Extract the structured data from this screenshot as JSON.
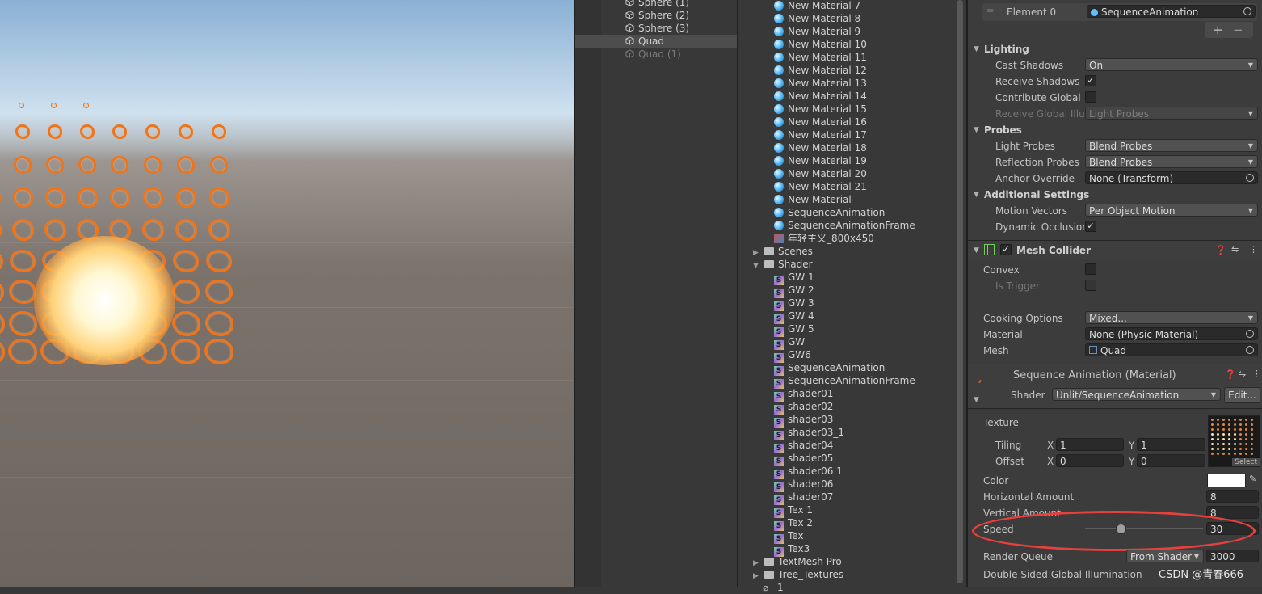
{
  "hierarchy": {
    "items": [
      "Sphere (1)",
      "Sphere (2)",
      "Sphere (3)",
      "Quad",
      "Quad (1)"
    ],
    "selected": "Quad"
  },
  "project": {
    "materials": [
      "New Material 7",
      "New Material 8",
      "New Material 9",
      "New Material 10",
      "New Material 11",
      "New Material 12",
      "New Material 13",
      "New Material 14",
      "New Material 15",
      "New Material 16",
      "New Material 17",
      "New Material 18",
      "New Material 19",
      "New Material 20",
      "New Material 21",
      "New Material",
      "SequenceAnimation",
      "SequenceAnimationFrame"
    ],
    "texture": "年轻主义_800x450",
    "folder_scenes": "Scenes",
    "folder_shader": "Shader",
    "shaders": [
      "GW 1",
      "GW 2",
      "GW 3",
      "GW 4",
      "GW 5",
      "GW",
      "GW6",
      "SequenceAnimation",
      "SequenceAnimationFrame",
      "shader01",
      "shader02",
      "shader03",
      "shader03_1",
      "shader04",
      "shader05",
      "shader06 1",
      "shader06",
      "shader07",
      "Tex 1",
      "Tex 2",
      "Tex",
      "Tex3"
    ],
    "folder_textmesh": "TextMesh Pro",
    "folder_tree": "Tree_Textures",
    "cutoff": "1"
  },
  "inspector": {
    "element0_label": "Element 0",
    "element0_value": "SequenceAnimation",
    "plus": "+",
    "minus": "−",
    "lighting": {
      "header": "Lighting",
      "cast_shadows_label": "Cast Shadows",
      "cast_shadows_value": "On",
      "receive_shadows_label": "Receive Shadows",
      "contribute_gi_label": "Contribute Global Ill",
      "receive_gi_label": "Receive Global Illum",
      "receive_gi_value": "Light Probes"
    },
    "probes": {
      "header": "Probes",
      "light_probes_label": "Light Probes",
      "light_probes_value": "Blend Probes",
      "reflection_probes_label": "Reflection Probes",
      "reflection_probes_value": "Blend Probes",
      "anchor_label": "Anchor Override",
      "anchor_value": "None (Transform)"
    },
    "additional": {
      "header": "Additional Settings",
      "motion_vectors_label": "Motion Vectors",
      "motion_vectors_value": "Per Object Motion",
      "dynamic_occlusion_label": "Dynamic Occlusion"
    },
    "mesh_collider": {
      "title": "Mesh Collider",
      "convex_label": "Convex",
      "is_trigger_label": "Is Trigger",
      "cooking_label": "Cooking Options",
      "cooking_value": "Mixed...",
      "material_label": "Material",
      "material_value": "None (Physic Material)",
      "mesh_label": "Mesh",
      "mesh_value": "Quad"
    },
    "material": {
      "title": "Sequence Animation (Material)",
      "shader_label": "Shader",
      "shader_value": "Unlit/SequenceAnimation",
      "edit_label": "Edit...",
      "texture_label": "Texture",
      "tiling_label": "Tiling",
      "offset_label": "Offset",
      "x": "X",
      "y": "Y",
      "tiling_x": "1",
      "tiling_y": "1",
      "offset_x": "0",
      "offset_y": "0",
      "select_label": "Select",
      "color_label": "Color",
      "color_value": "#ffffff",
      "h_amount_label": "Horizontal Amount",
      "h_amount": "8",
      "v_amount_label": "Vertical Amount",
      "v_amount": "8",
      "speed_label": "Speed",
      "speed_value": "30",
      "speed_fraction": 0.3,
      "render_queue_label": "Render Queue",
      "render_queue_mode": "From Shader",
      "render_queue_value": "3000",
      "dsgi_label": "Double Sided Global Illumination"
    }
  },
  "watermark": "CSDN @青春666",
  "colors": {
    "accent_highlight": "#e8403c",
    "frame_orange": "#f07419"
  }
}
